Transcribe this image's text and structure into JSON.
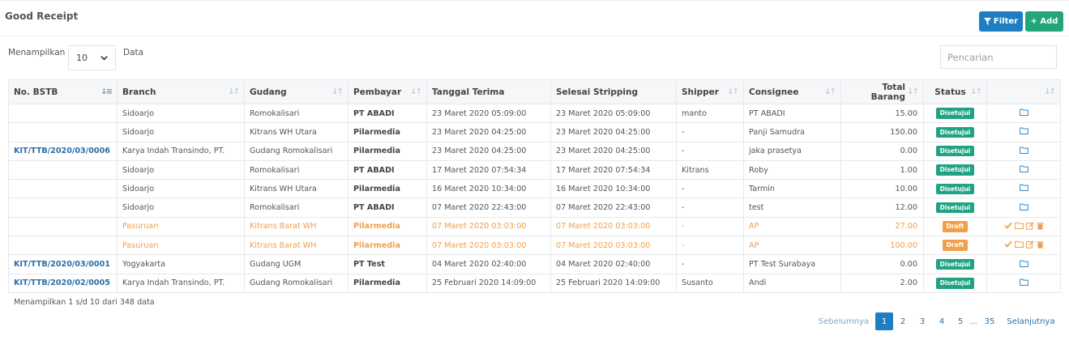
{
  "header": {
    "title": "Good Receipt",
    "filter_label": "Filter",
    "add_label": "+ Add"
  },
  "length": {
    "label": "Menampilkan",
    "value": "10",
    "suffix": "Data"
  },
  "search": {
    "placeholder": "Pencarian"
  },
  "columns": [
    "No. BSTB",
    "Branch",
    "Gudang",
    "Pembayar",
    "Tanggal Terima",
    "Selesai Stripping",
    "Shipper",
    "Consignee",
    "Total Barang",
    "Status",
    ""
  ],
  "rows": [
    {
      "no": "",
      "branch": "Sidoarjo",
      "gudang": "Romokalisari",
      "pembayar": "PT ABADI",
      "terima": "23 Maret 2020 05:09:00",
      "stripping": "23 Maret 2020 05:09:00",
      "shipper": "manto",
      "consignee": "PT ABADI",
      "total": "15.00",
      "status": "Disetujui",
      "draft": false
    },
    {
      "no": "",
      "branch": "Sidoarjo",
      "gudang": "Kitrans WH Utara",
      "pembayar": "Pilarmedia",
      "terima": "23 Maret 2020 04:25:00",
      "stripping": "23 Maret 2020 04:25:00",
      "shipper": "-",
      "consignee": "Panji Samudra",
      "total": "150.00",
      "status": "Disetujui",
      "draft": false
    },
    {
      "no": "KIT/TTB/2020/03/0006",
      "branch": "Karya Indah Transindo, PT.",
      "gudang": "Gudang Romokalisari",
      "pembayar": "Pilarmedia",
      "terima": "23 Maret 2020 04:25:00",
      "stripping": "23 Maret 2020 04:25:00",
      "shipper": "-",
      "consignee": "jaka prasetya",
      "total": "0.00",
      "status": "Disetujui",
      "draft": false
    },
    {
      "no": "",
      "branch": "Sidoarjo",
      "gudang": "Romokalisari",
      "pembayar": "PT ABADI",
      "terima": "17 Maret 2020 07:54:34",
      "stripping": "17 Maret 2020 07:54:34",
      "shipper": "Kitrans",
      "consignee": "Roby",
      "total": "1.00",
      "status": "Disetujui",
      "draft": false
    },
    {
      "no": "",
      "branch": "Sidoarjo",
      "gudang": "Kitrans WH Utara",
      "pembayar": "Pilarmedia",
      "terima": "16 Maret 2020 10:34:00",
      "stripping": "16 Maret 2020 10:34:00",
      "shipper": "-",
      "consignee": "Tarmin",
      "total": "10.00",
      "status": "Disetujui",
      "draft": false
    },
    {
      "no": "",
      "branch": "Sidoarjo",
      "gudang": "Romokalisari",
      "pembayar": "PT ABADI",
      "terima": "07 Maret 2020 22:43:00",
      "stripping": "07 Maret 2020 22:43:00",
      "shipper": "-",
      "consignee": "test",
      "total": "12.00",
      "status": "Disetujui",
      "draft": false
    },
    {
      "no": "",
      "branch": "Pasuruan",
      "gudang": "Kitrans Barat WH",
      "pembayar": "Pilarmedia",
      "terima": "07 Maret 2020 03:03:00",
      "stripping": "07 Maret 2020 03:03:00",
      "shipper": "-",
      "consignee": "AP",
      "total": "27.00",
      "status": "Draft",
      "draft": true
    },
    {
      "no": "",
      "branch": "Pasuruan",
      "gudang": "Kitrans Barat WH",
      "pembayar": "Pilarmedia",
      "terima": "07 Maret 2020 03:03:00",
      "stripping": "07 Maret 2020 03:03:00",
      "shipper": "-",
      "consignee": "AP",
      "total": "100.00",
      "status": "Draft",
      "draft": true
    },
    {
      "no": "KIT/TTB/2020/03/0001",
      "branch": "Yogyakarta",
      "gudang": "Gudang UGM",
      "pembayar": "PT Test",
      "terima": "04 Maret 2020 02:40:00",
      "stripping": "04 Maret 2020 02:40:00",
      "shipper": "-",
      "consignee": "PT Test Surabaya",
      "total": "0.00",
      "status": "Disetujui",
      "draft": false
    },
    {
      "no": "KIT/TTB/2020/02/0005",
      "branch": "Karya Indah Transindo, PT.",
      "gudang": "Gudang Romokalisari",
      "pembayar": "Pilarmedia",
      "terima": "25 Februari 2020 14:09:00",
      "stripping": "25 Februari 2020 14:09:00",
      "shipper": "Susanto",
      "consignee": "Andi",
      "total": "2.00",
      "status": "Disetujui",
      "draft": false
    }
  ],
  "info": "Menampilkan 1 s/d 10 dari 348 data",
  "pagination": {
    "prev": "Sebelumnya",
    "pages": [
      "1",
      "2",
      "3",
      "4",
      "5"
    ],
    "dots": "...",
    "last": "35",
    "next": "Selanjutnya",
    "active": "1"
  },
  "colors": {
    "primary": "#1f7ec2",
    "success": "#22a57a",
    "approved": "#1fa383",
    "draft": "#f0a04b",
    "link": "#2a6ea8"
  }
}
